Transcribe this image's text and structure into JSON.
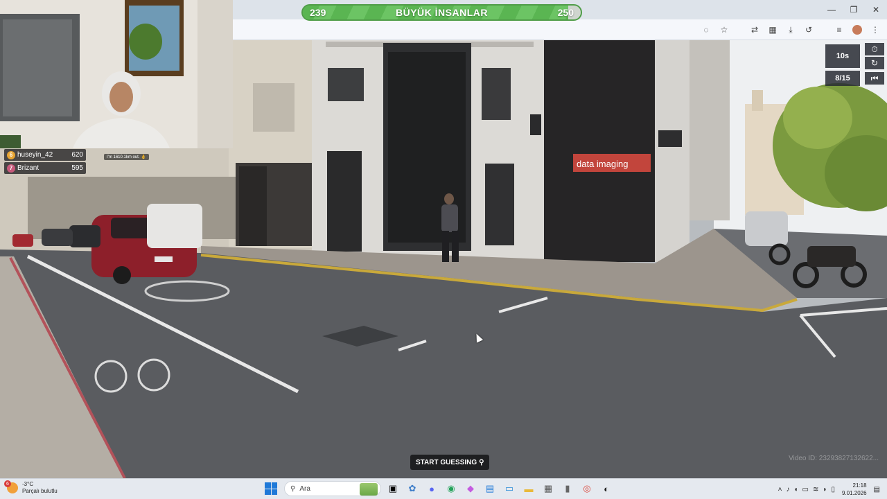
{
  "window": {
    "minimize": "—",
    "maximize": "❐",
    "close": "✕"
  },
  "toolbar_icons": [
    "eye-off-icon",
    "star-icon",
    "translate-icon",
    "extensions-icon",
    "download-icon",
    "history-icon",
    "media-icon",
    "profile-icon",
    "menu-icon"
  ],
  "progress": {
    "current": "239",
    "title": "BÜYÜK İNSANLAR",
    "target": "250",
    "fraction": 0.956,
    "color": "#5ab552"
  },
  "leaderboard": [
    {
      "rank": "6",
      "name": "huseyin_42",
      "score": "620",
      "rank_color": "#e7a431"
    },
    {
      "rank": "7",
      "name": "Brizant",
      "score": "595",
      "rank_color": "#c85a7c"
    }
  ],
  "webcam_caption": "I'm 1610.1km out. 👌",
  "timer": {
    "time": "10s",
    "round": "8/15"
  },
  "start_button": {
    "label": "START GUESSING"
  },
  "video_id": "Video ID: 23293827132622...",
  "scene_signs": {
    "storefront": "data imaging"
  },
  "taskbar": {
    "weather_badge": "6",
    "temperature": "-3°C",
    "weather_desc": "Parçalı bulutlu",
    "search_placeholder": "Ara",
    "time": "21:18",
    "date": "9.01.2026"
  }
}
